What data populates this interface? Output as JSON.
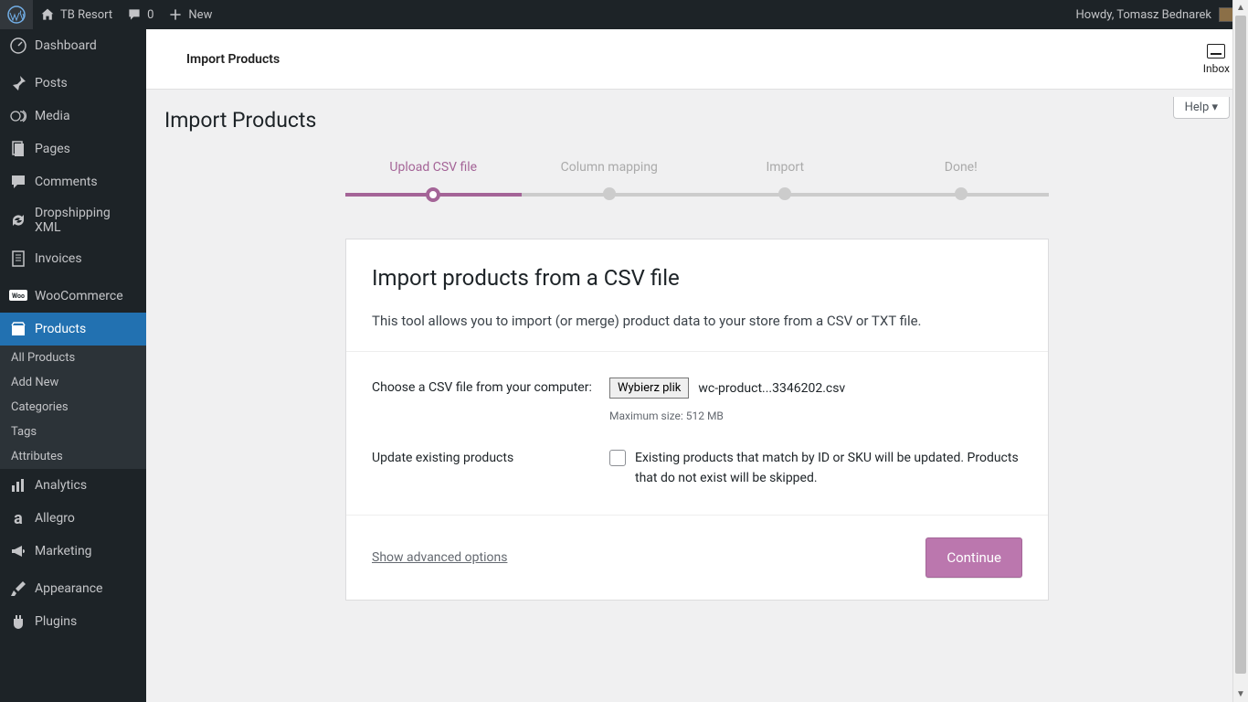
{
  "adminbar": {
    "site_name": "TB Resort",
    "comments_count": "0",
    "new_label": "New",
    "howdy": "Howdy, Tomasz Bednarek"
  },
  "sidebar": {
    "dashboard": "Dashboard",
    "posts": "Posts",
    "media": "Media",
    "pages": "Pages",
    "comments": "Comments",
    "dropshipping": "Dropshipping XML",
    "invoices": "Invoices",
    "woocommerce": "WooCommerce",
    "products": "Products",
    "submenu": {
      "all_products": "All Products",
      "add_new": "Add New",
      "categories": "Categories",
      "tags": "Tags",
      "attributes": "Attributes"
    },
    "analytics": "Analytics",
    "allegro": "Allegro",
    "marketing": "Marketing",
    "appearance": "Appearance",
    "plugins": "Plugins"
  },
  "topbar": {
    "title": "Import Products",
    "inbox": "Inbox"
  },
  "help": "Help ▾",
  "page": {
    "heading": "Import Products",
    "steps": [
      "Upload CSV file",
      "Column mapping",
      "Import",
      "Done!"
    ],
    "card_title": "Import products from a CSV file",
    "card_desc": "This tool allows you to import (or merge) product data to your store from a CSV or TXT file.",
    "choose_label": "Choose a CSV file from your computer:",
    "file_button": "Wybierz plik",
    "file_name": "wc-product...3346202.csv",
    "max_size": "Maximum size: 512 MB",
    "update_label": "Update existing products",
    "update_desc": "Existing products that match by ID or SKU will be updated. Products that do not exist will be skipped.",
    "advanced": "Show advanced options",
    "continue": "Continue"
  }
}
